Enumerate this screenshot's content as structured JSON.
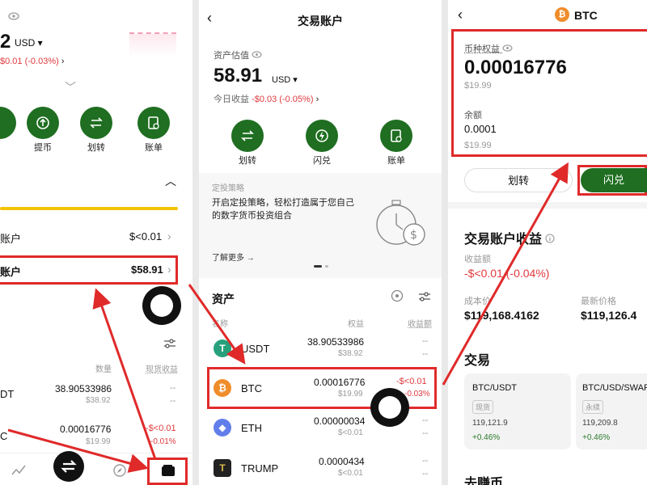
{
  "p1": {
    "balance_partial": "2",
    "currency": "USD",
    "change": "$0.01 (-0.03%)",
    "actions": [
      "提币",
      "划转",
      "账单"
    ],
    "rows": [
      {
        "label": "账户",
        "value": "$<0.01"
      },
      {
        "label": "账户",
        "value": "$58.91"
      }
    ],
    "col_qty": "数量",
    "col_gain": "现货收益",
    "assets": [
      {
        "sym": "DT",
        "qty": "38.90533986",
        "usd": "$38.92",
        "gain": "--",
        "pct": "--"
      },
      {
        "sym": "C",
        "qty": "0.00016776",
        "usd": "$19.99",
        "gain": "-$<0.01",
        "pct": "-0.01%"
      }
    ]
  },
  "p2": {
    "title": "交易账户",
    "est_label": "资产估值",
    "balance": "58.91",
    "currency": "USD",
    "today_label": "今日收益",
    "today_value": "-$0.03 (-0.05%)",
    "actions": [
      "划转",
      "闪兑",
      "账单"
    ],
    "dca_title": "定投策略",
    "dca_line1": "开启定投策略，轻松打造属于您自己",
    "dca_line2": "的数字货币投资组合",
    "learn_more": "了解更多 →",
    "assets_heading": "资产",
    "col_name": "名称",
    "col_equity": "权益",
    "col_gain": "收益额",
    "assets": [
      {
        "sym": "USDT",
        "qty": "38.90533986",
        "usd": "$38.92",
        "gain": "--",
        "pct": "--",
        "color": "#26a17b",
        "glyph": "T"
      },
      {
        "sym": "BTC",
        "qty": "0.00016776",
        "usd": "$19.99",
        "gain": "-$<0.01",
        "pct": "-0.03%",
        "color": "#f08c2a",
        "glyph": "₿"
      },
      {
        "sym": "ETH",
        "qty": "0.00000034",
        "usd": "$<0.01",
        "gain": "--",
        "pct": "--",
        "color": "#627eea",
        "glyph": "◆"
      },
      {
        "sym": "TRUMP",
        "qty": "0.0000434",
        "usd": "$<0.01",
        "gain": "--",
        "pct": "--",
        "color": "#222222",
        "glyph": "T"
      }
    ]
  },
  "p3": {
    "title": "BTC",
    "equity_label": "币种权益",
    "equity_value": "0.00016776",
    "equity_usd": "$19.99",
    "balance_label": "余额",
    "balance_value": "0.0001",
    "balance_usd": "$19.99",
    "btn_transfer": "划转",
    "btn_swap": "闪兑",
    "pnl_heading": "交易账户收益",
    "pnl_label": "收益额",
    "pnl_value": "-$<0.01 (-0.04%)",
    "cost_label": "成本价",
    "cost_value": "$119,168.4162",
    "last_label": "最新价格",
    "last_value": "$119,126.4",
    "trade_heading": "交易",
    "pairs": [
      {
        "name": "BTC/USDT",
        "tag": "现货",
        "price": "119,121.9",
        "chg": "+0.46%"
      },
      {
        "name": "BTC/USD/SWAP",
        "tag": "永续",
        "price": "119,209.8",
        "chg": "+0.46%"
      }
    ],
    "bottom_heading": "去赚币"
  },
  "colors": {
    "brand_green": "#1f6e21",
    "highlight_red": "#e02a2a",
    "loss_red": "#e0393e"
  }
}
